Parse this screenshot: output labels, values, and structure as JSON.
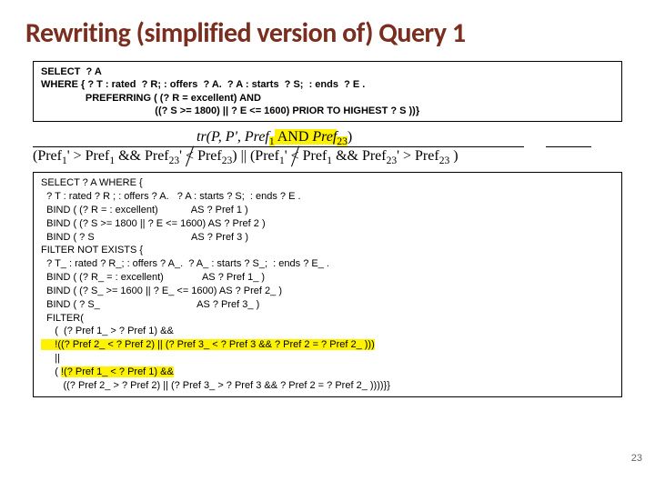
{
  "title": "Rewriting (simplified version of) Query 1",
  "query1": {
    "l1": "SELECT  ? A",
    "l2": "WHERE { ? T : rated  ? R; : offers  ? A.  ? A : starts  ? S;  : ends  ? E .",
    "l3": "                PREFERRING ( (? R = excellent) AND",
    "l4": "                                         ((? S >= 1800) || ? E <= 1600) PRIOR TO HIGHEST ? S ))}"
  },
  "rule": {
    "top_prefix": "tr(P, P', Pref",
    "top_mid_sub": "1",
    "top_and": " AND ",
    "top_suffix_pref": "Pref",
    "top_suffix_sub": "23",
    "top_close": ")",
    "bot_a": "(Pref",
    "bot_b": "' > Pref",
    "bot_c": " && Pref",
    "bot_d": "' ",
    "bot_e": " Pref",
    "bot_f": ") || (Pref",
    "bot_g": "' ",
    "bot_h": " Pref",
    "bot_i": " && Pref",
    "bot_j": "' > Pref",
    "bot_k": " )"
  },
  "query2": {
    "l1": "SELECT ? A WHERE {",
    "l2": "  ? T : rated ? R ; : offers ? A.   ? A : starts ? S;  : ends ? E .",
    "l3": "  BIND ( (? R = : excellent)            AS ? Pref 1 )",
    "l4": "  BIND ( (? S >= 1800 || ? E <= 1600) AS ? Pref 2 )",
    "l5": "  BIND ( ? S                                   AS ? Pref 3 )",
    "l6": "FILTER NOT EXISTS {",
    "l7": "  ? T_ : rated ? R_; : offers ? A_.  ? A_ : starts ? S_;  : ends ? E_ .",
    "l8": "  BIND ( (? R_ = : excellent)              AS ? Pref 1_ )",
    "l9": "  BIND ( (? S_ >= 1600 || ? E_ <= 1600) AS ? Pref 2_ )",
    "l10": "  BIND ( ? S_                                   AS ? Pref 3_ )",
    "l11": "  FILTER(",
    "l12_a": "     (  (? Pref 1_ > ? Pref 1) &&",
    "l12_b": "     !((? Pref 2_ < ? Pref 2) || (? Pref 3_ < ? Pref 3 && ? Pref 2 = ? Pref 2_ )))",
    "l13": "     ||",
    "l14_a": "     ( ",
    "l14_b": "!(? Pref 1_ < ? Pref 1) &&",
    "l15": "        ((? Pref 2_ > ? Pref 2) || (? Pref 3_ > ? Pref 3 && ? Pref 2 = ? Pref 2_ ))))}}"
  },
  "page": "23"
}
